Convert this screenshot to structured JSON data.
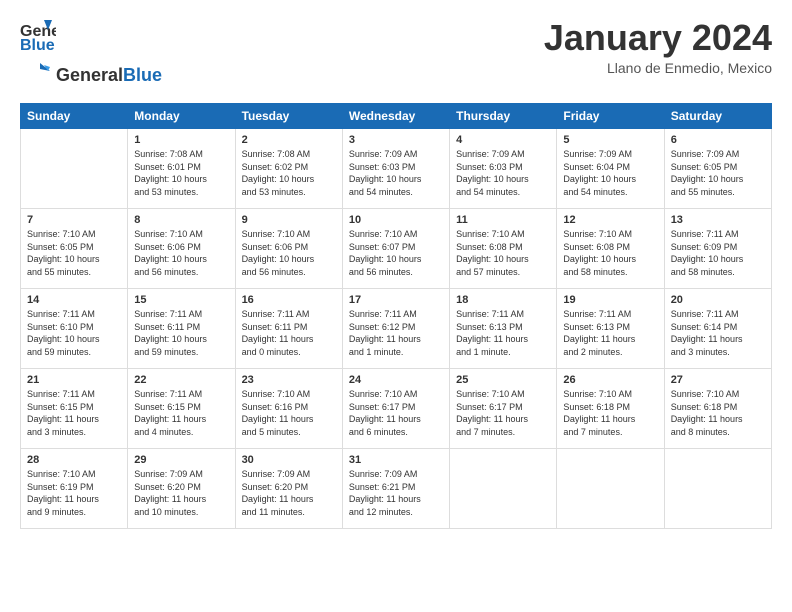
{
  "header": {
    "logo_general": "General",
    "logo_blue": "Blue",
    "month_title": "January 2024",
    "location": "Llano de Enmedio, Mexico"
  },
  "days_of_week": [
    "Sunday",
    "Monday",
    "Tuesday",
    "Wednesday",
    "Thursday",
    "Friday",
    "Saturday"
  ],
  "weeks": [
    [
      {
        "day": "",
        "info": ""
      },
      {
        "day": "1",
        "info": "Sunrise: 7:08 AM\nSunset: 6:01 PM\nDaylight: 10 hours\nand 53 minutes."
      },
      {
        "day": "2",
        "info": "Sunrise: 7:08 AM\nSunset: 6:02 PM\nDaylight: 10 hours\nand 53 minutes."
      },
      {
        "day": "3",
        "info": "Sunrise: 7:09 AM\nSunset: 6:03 PM\nDaylight: 10 hours\nand 54 minutes."
      },
      {
        "day": "4",
        "info": "Sunrise: 7:09 AM\nSunset: 6:03 PM\nDaylight: 10 hours\nand 54 minutes."
      },
      {
        "day": "5",
        "info": "Sunrise: 7:09 AM\nSunset: 6:04 PM\nDaylight: 10 hours\nand 54 minutes."
      },
      {
        "day": "6",
        "info": "Sunrise: 7:09 AM\nSunset: 6:05 PM\nDaylight: 10 hours\nand 55 minutes."
      }
    ],
    [
      {
        "day": "7",
        "info": "Sunrise: 7:10 AM\nSunset: 6:05 PM\nDaylight: 10 hours\nand 55 minutes."
      },
      {
        "day": "8",
        "info": "Sunrise: 7:10 AM\nSunset: 6:06 PM\nDaylight: 10 hours\nand 56 minutes."
      },
      {
        "day": "9",
        "info": "Sunrise: 7:10 AM\nSunset: 6:06 PM\nDaylight: 10 hours\nand 56 minutes."
      },
      {
        "day": "10",
        "info": "Sunrise: 7:10 AM\nSunset: 6:07 PM\nDaylight: 10 hours\nand 56 minutes."
      },
      {
        "day": "11",
        "info": "Sunrise: 7:10 AM\nSunset: 6:08 PM\nDaylight: 10 hours\nand 57 minutes."
      },
      {
        "day": "12",
        "info": "Sunrise: 7:10 AM\nSunset: 6:08 PM\nDaylight: 10 hours\nand 58 minutes."
      },
      {
        "day": "13",
        "info": "Sunrise: 7:11 AM\nSunset: 6:09 PM\nDaylight: 10 hours\nand 58 minutes."
      }
    ],
    [
      {
        "day": "14",
        "info": "Sunrise: 7:11 AM\nSunset: 6:10 PM\nDaylight: 10 hours\nand 59 minutes."
      },
      {
        "day": "15",
        "info": "Sunrise: 7:11 AM\nSunset: 6:11 PM\nDaylight: 10 hours\nand 59 minutes."
      },
      {
        "day": "16",
        "info": "Sunrise: 7:11 AM\nSunset: 6:11 PM\nDaylight: 11 hours\nand 0 minutes."
      },
      {
        "day": "17",
        "info": "Sunrise: 7:11 AM\nSunset: 6:12 PM\nDaylight: 11 hours\nand 1 minute."
      },
      {
        "day": "18",
        "info": "Sunrise: 7:11 AM\nSunset: 6:13 PM\nDaylight: 11 hours\nand 1 minute."
      },
      {
        "day": "19",
        "info": "Sunrise: 7:11 AM\nSunset: 6:13 PM\nDaylight: 11 hours\nand 2 minutes."
      },
      {
        "day": "20",
        "info": "Sunrise: 7:11 AM\nSunset: 6:14 PM\nDaylight: 11 hours\nand 3 minutes."
      }
    ],
    [
      {
        "day": "21",
        "info": "Sunrise: 7:11 AM\nSunset: 6:15 PM\nDaylight: 11 hours\nand 3 minutes."
      },
      {
        "day": "22",
        "info": "Sunrise: 7:11 AM\nSunset: 6:15 PM\nDaylight: 11 hours\nand 4 minutes."
      },
      {
        "day": "23",
        "info": "Sunrise: 7:10 AM\nSunset: 6:16 PM\nDaylight: 11 hours\nand 5 minutes."
      },
      {
        "day": "24",
        "info": "Sunrise: 7:10 AM\nSunset: 6:17 PM\nDaylight: 11 hours\nand 6 minutes."
      },
      {
        "day": "25",
        "info": "Sunrise: 7:10 AM\nSunset: 6:17 PM\nDaylight: 11 hours\nand 7 minutes."
      },
      {
        "day": "26",
        "info": "Sunrise: 7:10 AM\nSunset: 6:18 PM\nDaylight: 11 hours\nand 7 minutes."
      },
      {
        "day": "27",
        "info": "Sunrise: 7:10 AM\nSunset: 6:18 PM\nDaylight: 11 hours\nand 8 minutes."
      }
    ],
    [
      {
        "day": "28",
        "info": "Sunrise: 7:10 AM\nSunset: 6:19 PM\nDaylight: 11 hours\nand 9 minutes."
      },
      {
        "day": "29",
        "info": "Sunrise: 7:09 AM\nSunset: 6:20 PM\nDaylight: 11 hours\nand 10 minutes."
      },
      {
        "day": "30",
        "info": "Sunrise: 7:09 AM\nSunset: 6:20 PM\nDaylight: 11 hours\nand 11 minutes."
      },
      {
        "day": "31",
        "info": "Sunrise: 7:09 AM\nSunset: 6:21 PM\nDaylight: 11 hours\nand 12 minutes."
      },
      {
        "day": "",
        "info": ""
      },
      {
        "day": "",
        "info": ""
      },
      {
        "day": "",
        "info": ""
      }
    ]
  ]
}
